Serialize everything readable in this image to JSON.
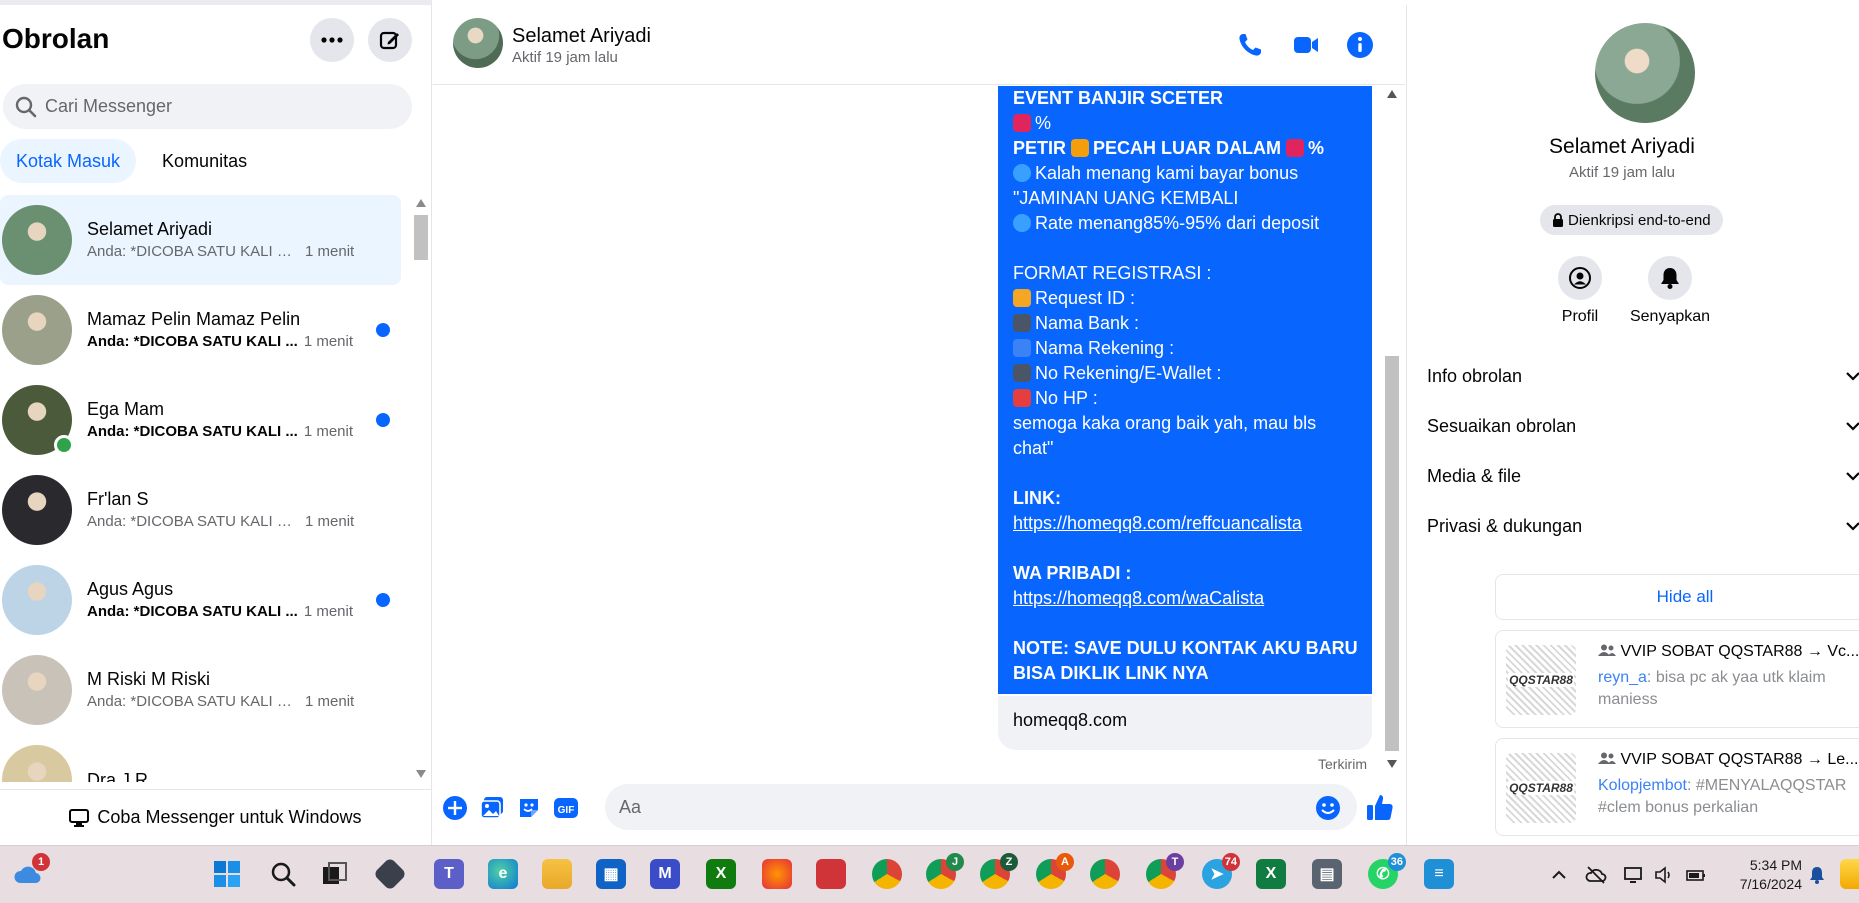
{
  "sidebar": {
    "title": "Obrolan",
    "search_placeholder": "Cari Messenger",
    "tabs": [
      {
        "label": "Kotak Masuk",
        "active": true
      },
      {
        "label": "Komunitas",
        "active": false
      }
    ],
    "chats": [
      {
        "name": "Selamet Ariyadi",
        "preview": "Anda: *DICOBA SATU KALI SA...",
        "time": "1 menit",
        "unread": false,
        "selected": true,
        "online": false,
        "avatar_color": "#6b8f71"
      },
      {
        "name": "Mamaz Pelin Mamaz Pelin",
        "preview": "Anda: *DICOBA SATU KALI ...",
        "time": "1 menit",
        "unread": true,
        "selected": false,
        "online": false,
        "avatar_color": "#9aa08a"
      },
      {
        "name": "Ega Mam",
        "preview": "Anda: *DICOBA SATU KALI ...",
        "time": "1 menit",
        "unread": true,
        "selected": false,
        "online": true,
        "avatar_color": "#4b5a3a"
      },
      {
        "name": "Fr'lan S",
        "preview": "Anda: *DICOBA SATU KALI SA...",
        "time": "1 menit",
        "unread": false,
        "selected": false,
        "online": false,
        "avatar_color": "#2a2a2e"
      },
      {
        "name": "Agus Agus",
        "preview": "Anda: *DICOBA SATU KALI ...",
        "time": "1 menit",
        "unread": true,
        "selected": false,
        "online": false,
        "avatar_color": "#bcd4e6"
      },
      {
        "name": "M Riski M Riski",
        "preview": "Anda: *DICOBA SATU KALI SA...",
        "time": "1 menit",
        "unread": false,
        "selected": false,
        "online": false,
        "avatar_color": "#c9c2b8"
      },
      {
        "name": "Dra J R",
        "preview": "",
        "time": "",
        "unread": false,
        "selected": false,
        "online": false,
        "avatar_color": "#d9c9a0"
      }
    ],
    "try_windows_label": "Coba Messenger untuk Windows"
  },
  "conversation": {
    "name": "Selamet Ariyadi",
    "status": "Aktif 19 jam lalu",
    "message_lines": [
      {
        "text": "EVENT BANJIR SCETER",
        "style": "b",
        "emoji": ""
      },
      {
        "text": "%",
        "style": "",
        "emoji": "hundred"
      },
      {
        "text": "PETIR",
        "style": "b",
        "emoji": "",
        "suffix_emoji": "bolt",
        "suffix": "PECAH LUAR DALAM",
        "suffix2_emoji": "hundred",
        "suffix2": "%"
      },
      {
        "text": "Kalah menang kami bayar bonus",
        "style": "",
        "emoji": "blue-circle"
      },
      {
        "text": "\"JAMINAN UANG KEMBALI",
        "style": "",
        "emoji": ""
      },
      {
        "text": "Rate menang85%-95% dari deposit",
        "style": "",
        "emoji": "blue-circle"
      },
      {
        "text": "",
        "style": "",
        "emoji": ""
      },
      {
        "text": "FORMAT REGISTRASI :",
        "style": "",
        "emoji": ""
      },
      {
        "text": "Request ID :",
        "style": "",
        "emoji": "id"
      },
      {
        "text": "Nama Bank :",
        "style": "",
        "emoji": "atm"
      },
      {
        "text": "Nama Rekening :",
        "style": "",
        "emoji": "restroom"
      },
      {
        "text": "No Rekening/E-Wallet :",
        "style": "",
        "emoji": "atm"
      },
      {
        "text": "No HP :",
        "style": "",
        "emoji": "sos"
      },
      {
        "text": "semoga kaka orang baik yah, mau bls",
        "style": "",
        "emoji": ""
      },
      {
        "text": "chat\"",
        "style": "",
        "emoji": ""
      },
      {
        "text": "",
        "style": "",
        "emoji": ""
      },
      {
        "text": "LINK:",
        "style": "b",
        "emoji": ""
      },
      {
        "text": "https://homeqq8.com/reffcuancalista",
        "style": "u",
        "emoji": ""
      },
      {
        "text": "",
        "style": "",
        "emoji": ""
      },
      {
        "text": "WA PRIBADI :",
        "style": "b",
        "emoji": ""
      },
      {
        "text": "https://homeqq8.com/waCalista",
        "style": "u",
        "emoji": ""
      },
      {
        "text": "",
        "style": "",
        "emoji": ""
      },
      {
        "text": "NOTE: SAVE DULU KONTAK AKU BARU",
        "style": "b",
        "emoji": ""
      },
      {
        "text": "BISA DIKLIK LINK NYA",
        "style": "b",
        "emoji": ""
      }
    ],
    "link_card": "homeqq8.com",
    "sent_label": "Terkirim",
    "composer_placeholder": "Aa"
  },
  "right_panel": {
    "name": "Selamet Ariyadi",
    "status": "Aktif 19 jam lalu",
    "encryption": "Dienkripsi end-to-end",
    "actions": [
      {
        "label": "Profil",
        "icon": "profile-icon"
      },
      {
        "label": "Senyapkan",
        "icon": "bell-icon"
      }
    ],
    "sections": [
      "Info obrolan",
      "Sesuaikan obrolan",
      "Media & file",
      "Privasi & dukungan"
    ],
    "hide_all": "Hide all",
    "notifications": [
      {
        "title": "VVIP SOBAT QQSTAR88 → Vc...",
        "who": "reyn_a",
        "body": ": bisa pc ak yaa utk klaim maniess",
        "logo": "QQSTAR88"
      },
      {
        "title": "VVIP SOBAT QQSTAR88 → Le...",
        "who": "Kolopjembot",
        "body": ": #MENYALAQQSTAR #clem bonus perkalian",
        "logo": "QQSTAR88"
      }
    ]
  },
  "taskbar": {
    "time": "5:34 PM",
    "date": "7/16/2024",
    "weather_badge": "1",
    "telegram_badge": "74",
    "whatsapp_badge": "36",
    "chrome_profiles": [
      "",
      "J",
      "Z",
      "A",
      "",
      "T"
    ]
  },
  "colors": {
    "accent": "#0866ff",
    "selected_bg": "#ebf5ff",
    "muted": "#65676b",
    "online": "#31a24c"
  }
}
